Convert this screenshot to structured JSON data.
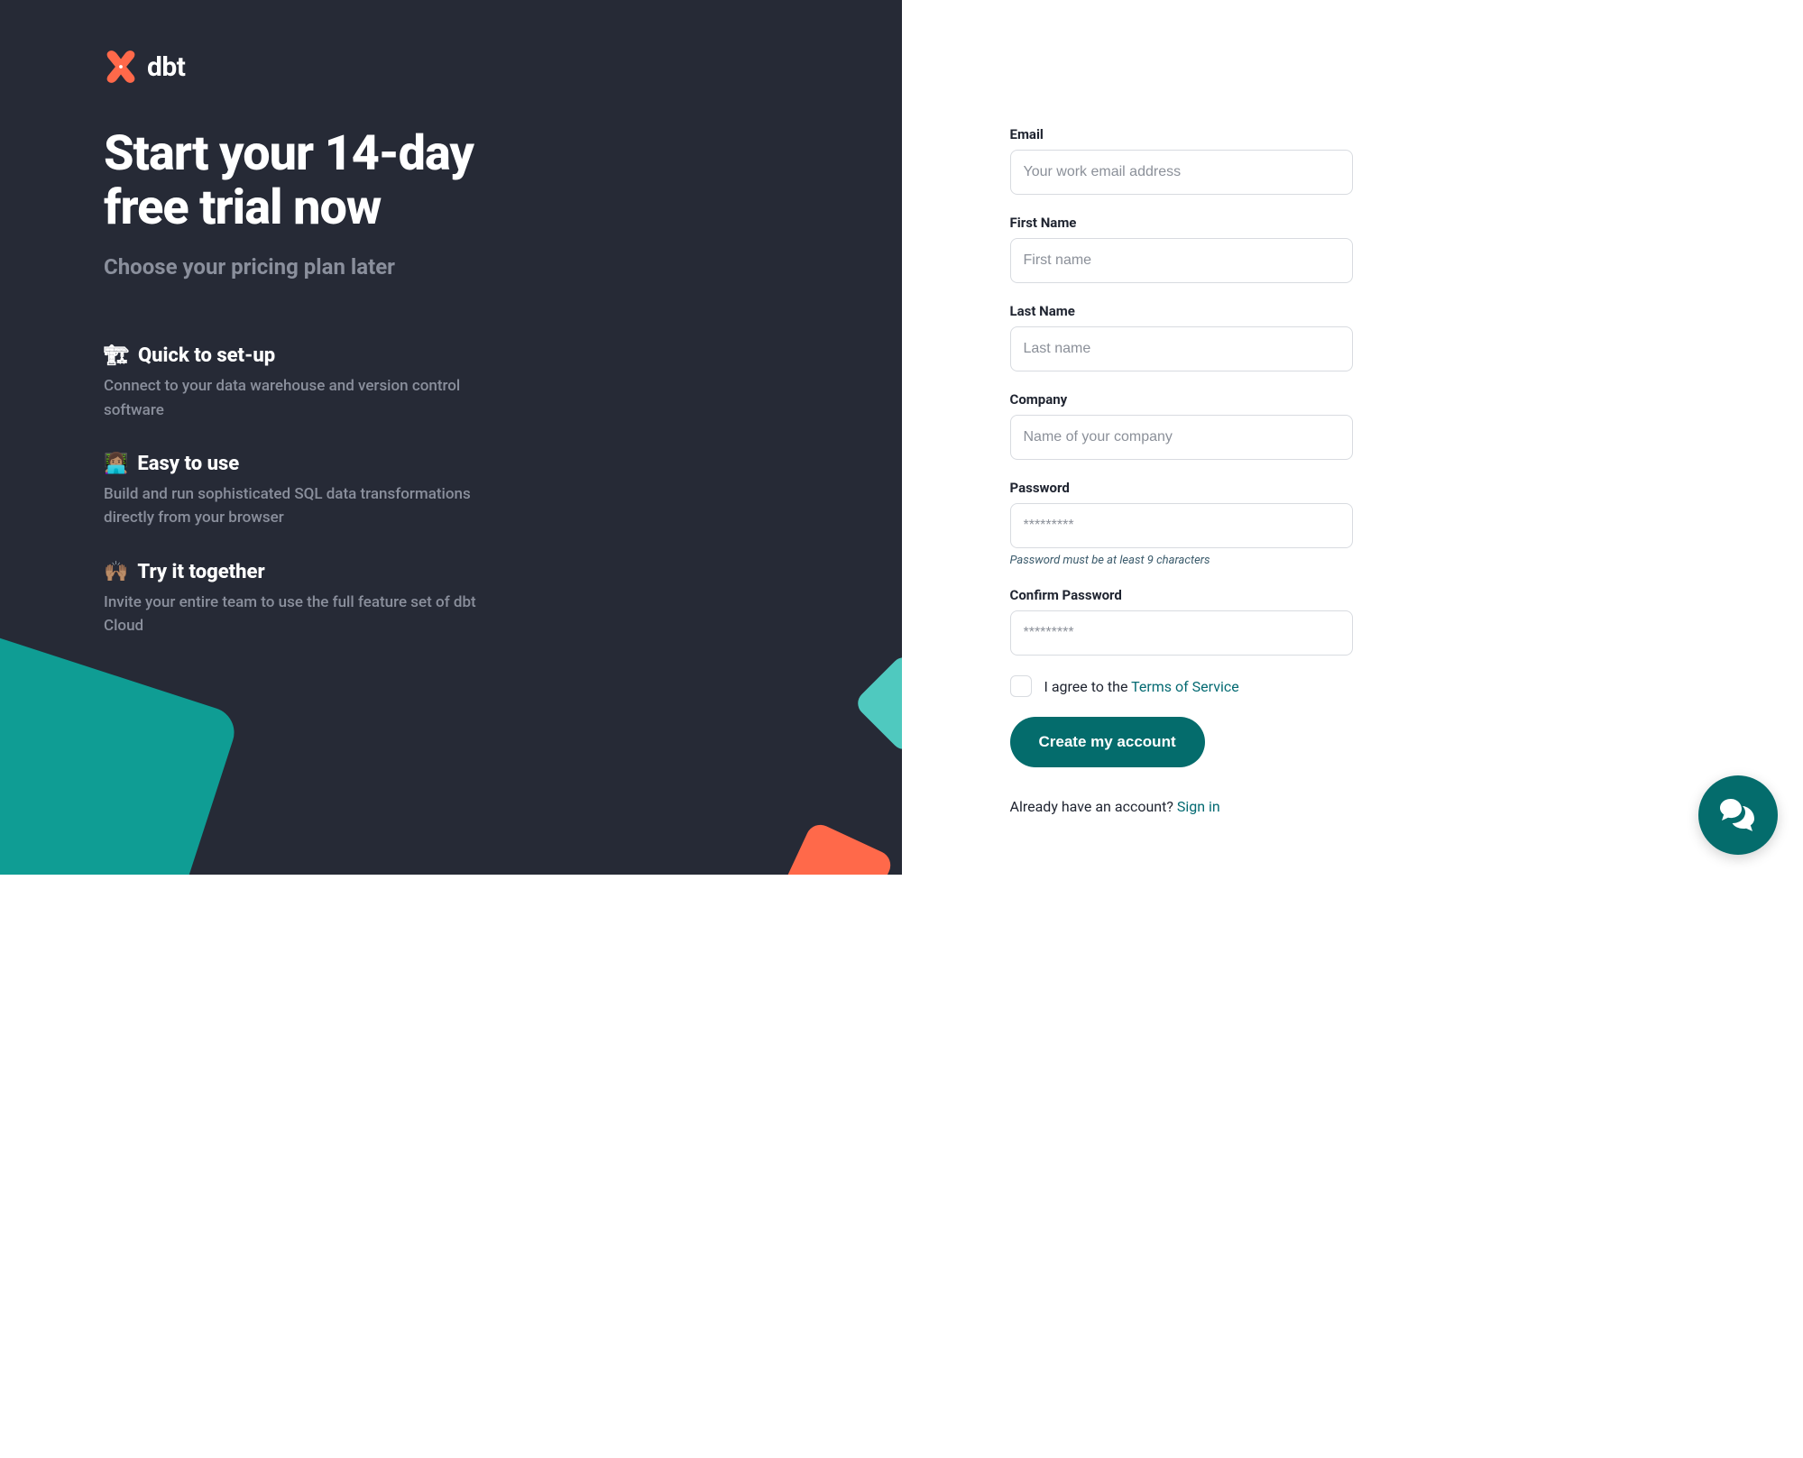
{
  "brand": {
    "name": "dbt"
  },
  "left": {
    "headline": "Start your 14-day free trial now",
    "subhead": "Choose your pricing plan later",
    "features": [
      {
        "emoji": "🏗",
        "title": "Quick to set-up",
        "desc": "Connect to your data warehouse and version control software"
      },
      {
        "emoji": "👩🏽‍💻",
        "title": "Easy to use",
        "desc": "Build and run sophisticated SQL data transformations directly from your browser"
      },
      {
        "emoji": "🙌🏽",
        "title": "Try it together",
        "desc": "Invite your entire team to use the full feature set of dbt Cloud"
      }
    ]
  },
  "form": {
    "email": {
      "label": "Email",
      "placeholder": "Your work email address"
    },
    "first": {
      "label": "First Name",
      "placeholder": "First name"
    },
    "last": {
      "label": "Last Name",
      "placeholder": "Last name"
    },
    "company": {
      "label": "Company",
      "placeholder": "Name of your company"
    },
    "password": {
      "label": "Password",
      "placeholder": "*********",
      "hint": "Password must be at least 9 characters"
    },
    "confirm": {
      "label": "Confirm Password",
      "placeholder": "*********"
    },
    "tos": {
      "prefix": "I agree to the ",
      "link": "Terms of Service"
    },
    "submit": "Create my account",
    "signin": {
      "prefix": "Already have an account? ",
      "link": "Sign in"
    }
  },
  "colors": {
    "accent": "#ff694a",
    "teal": "#046c6c"
  }
}
